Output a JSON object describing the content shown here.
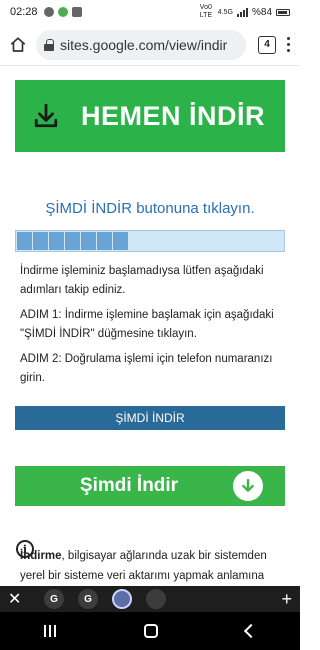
{
  "status_bar": {
    "time": "02:28",
    "network_label": "Vo0 LTE",
    "signal_label": "4.5G",
    "battery_text": "%84"
  },
  "browser": {
    "url": "sites.google.com/view/indir",
    "tab_count": "4"
  },
  "page": {
    "hero_button_label": "HEMEN İNDİR",
    "instruction": "ŞİMDİ İNDİR butonuna  tıklayın.",
    "progress_fraction": 0.45,
    "para1": "İndirme işleminiz başlamadıysa lütfen aşağıdaki adımları takip ediniz.",
    "para2": "ADIM 1: İndirme işlemine başlamak için aşağıdaki \"ŞİMDİ İNDİR\" düğmesine tıklayın.",
    "para3": "ADIM 2: Doğrulama işlemi için telefon numaranızı girin.",
    "download_bar_label": "ŞİMDİ İNDİR",
    "green_button_label": "Şimdi İndir",
    "desc_bold": "İndirme",
    "desc_text": ", bilgisayar ağlarında uzak bir sistemden yerel bir sisteme veri aktarımı yapmak anlamına gelir. İndirme"
  },
  "bottom_toolbar": {
    "close_glyph": "✕",
    "add_glyph": "+",
    "tab1_letter": "G",
    "tab2_letter": "G"
  },
  "colors": {
    "hero_green": "#2bb34a",
    "link_blue": "#2a6fb8",
    "bar_blue": "#2a6a99",
    "button_green": "#39b54a"
  },
  "icons": [
    "home-icon",
    "lock-icon",
    "tabs-icon",
    "menu-icon",
    "download-icon",
    "arrow-down-circle-icon",
    "info-icon",
    "close-icon",
    "add-icon"
  ]
}
